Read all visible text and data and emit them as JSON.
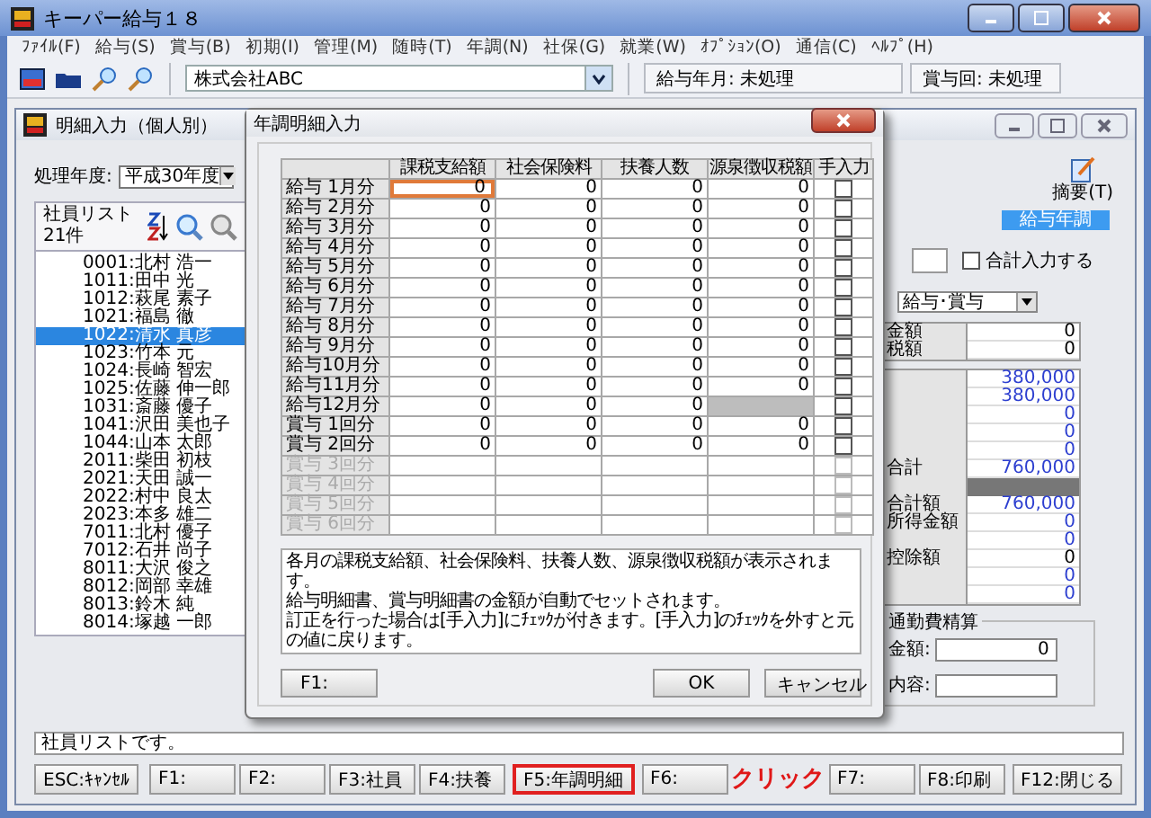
{
  "window": {
    "title": "キーパー給与１８"
  },
  "menu": [
    "ﾌｧｲﾙ(F)",
    "給与(S)",
    "賞与(B)",
    "初期(I)",
    "管理(M)",
    "随時(T)",
    "年調(N)",
    "社保(G)",
    "就業(W)",
    "ｵﾌﾟｼｮﾝ(O)",
    "通信(C)",
    "ﾍﾙﾌﾟ(H)"
  ],
  "toolbar": {
    "company": "株式会社ABC",
    "pay_month": "給与年月: 未処理",
    "bonus": "賞与回: 未処理"
  },
  "child_window": {
    "title": "明細入力（個人別）",
    "year_label": "処理年度:",
    "year": "平成30年度",
    "employee_list": {
      "title": "社員リスト",
      "count": "21件",
      "items": [
        {
          "label": "0001:北村 浩一",
          "selected": false
        },
        {
          "label": "1011:田中 光",
          "selected": false
        },
        {
          "label": "1012:萩尾 素子",
          "selected": false
        },
        {
          "label": "1021:福島 徹",
          "selected": false
        },
        {
          "label": "1022:清水 真彦",
          "selected": true
        },
        {
          "label": "1023:竹本 元",
          "selected": false
        },
        {
          "label": "1024:長崎 智宏",
          "selected": false
        },
        {
          "label": "1025:佐藤 伸一郎",
          "selected": false
        },
        {
          "label": "1031:斎藤 優子",
          "selected": false
        },
        {
          "label": "1041:沢田 美也子",
          "selected": false
        },
        {
          "label": "1044:山本 太郎",
          "selected": false
        },
        {
          "label": "2011:柴田 初枝",
          "selected": false
        },
        {
          "label": "2021:天田 誠一",
          "selected": false
        },
        {
          "label": "2022:村中 良太",
          "selected": false
        },
        {
          "label": "2023:本多 雄二",
          "selected": false
        },
        {
          "label": "7011:北村 優子",
          "selected": false
        },
        {
          "label": "7012:石井 尚子",
          "selected": false
        },
        {
          "label": "8011:大沢 俊之",
          "selected": false
        },
        {
          "label": "8012:岡部 幸雄",
          "selected": false
        },
        {
          "label": "8013:鈴木 純",
          "selected": false
        },
        {
          "label": "8014:塚越 一郎",
          "selected": false
        }
      ]
    },
    "summary_button": "摘要(T)",
    "tab": "給与年調",
    "total_input": {
      "label": "合計入力する",
      "checked": false
    },
    "type_select": "給与･賞与",
    "amounts_top": [
      {
        "label": "金額",
        "value": "0"
      },
      {
        "label": "税額",
        "value": "0"
      }
    ],
    "amounts": [
      {
        "kind": "value",
        "value": "380,000",
        "computed": true
      },
      {
        "kind": "value",
        "value": "380,000",
        "computed": true
      },
      {
        "kind": "value",
        "value": "0",
        "computed": true
      },
      {
        "kind": "value",
        "value": "0",
        "computed": true
      },
      {
        "kind": "value",
        "value": "0",
        "computed": true
      },
      {
        "kind": "value",
        "label": "合計",
        "value": "760,000",
        "computed": true
      },
      {
        "kind": "shaded"
      },
      {
        "kind": "value",
        "label": "合計額",
        "value": "760,000",
        "computed": true
      },
      {
        "kind": "value",
        "label": "所得金額",
        "value": "0",
        "computed": true
      },
      {
        "kind": "value",
        "value": "0",
        "computed": true
      },
      {
        "kind": "value",
        "label": "控除額",
        "value": "0",
        "computed": false
      },
      {
        "kind": "value",
        "value": "0",
        "computed": true
      },
      {
        "kind": "value",
        "value": "0",
        "computed": true
      }
    ],
    "commute": {
      "title": "通勤費精算",
      "amount_label": "金額:",
      "amount": "0",
      "note_label": "内容:"
    },
    "status": "社員リストです。",
    "function_keys": [
      {
        "label": "ESC:ｷｬﾝｾﾙ",
        "highlighted": false
      },
      {
        "label": "F1:",
        "highlighted": false
      },
      {
        "label": "F2:",
        "highlighted": false
      },
      {
        "label": "F3:社員",
        "highlighted": false
      },
      {
        "label": "F4:扶養",
        "highlighted": false
      },
      {
        "label": "F5:年調明細",
        "highlighted": true
      },
      {
        "label": "F6:",
        "highlighted": false
      },
      {
        "label": "F7:",
        "highlighted": false
      },
      {
        "label": "F8:印刷",
        "highlighted": false
      },
      {
        "label": "F12:閉じる",
        "highlighted": false
      }
    ],
    "annotation": "クリック"
  },
  "dialog": {
    "title": "年調明細入力",
    "columns": [
      "課税支給額",
      "社会保険料",
      "扶養人数",
      "源泉徴収税額",
      "手入力"
    ],
    "rows": [
      {
        "label": "給与 1月分",
        "values": [
          "0",
          "0",
          "0",
          "0"
        ],
        "manual": false,
        "disabled": false,
        "editing": true
      },
      {
        "label": "給与 2月分",
        "values": [
          "0",
          "0",
          "0",
          "0"
        ],
        "manual": false,
        "disabled": false,
        "editing": false
      },
      {
        "label": "給与 3月分",
        "values": [
          "0",
          "0",
          "0",
          "0"
        ],
        "manual": false,
        "disabled": false,
        "editing": false
      },
      {
        "label": "給与 4月分",
        "values": [
          "0",
          "0",
          "0",
          "0"
        ],
        "manual": false,
        "disabled": false,
        "editing": false
      },
      {
        "label": "給与 5月分",
        "values": [
          "0",
          "0",
          "0",
          "0"
        ],
        "manual": false,
        "disabled": false,
        "editing": false
      },
      {
        "label": "給与 6月分",
        "values": [
          "0",
          "0",
          "0",
          "0"
        ],
        "manual": false,
        "disabled": false,
        "editing": false
      },
      {
        "label": "給与 7月分",
        "values": [
          "0",
          "0",
          "0",
          "0"
        ],
        "manual": false,
        "disabled": false,
        "editing": false
      },
      {
        "label": "給与 8月分",
        "values": [
          "0",
          "0",
          "0",
          "0"
        ],
        "manual": false,
        "disabled": false,
        "editing": false
      },
      {
        "label": "給与 9月分",
        "values": [
          "0",
          "0",
          "0",
          "0"
        ],
        "manual": false,
        "disabled": false,
        "editing": false
      },
      {
        "label": "給与10月分",
        "values": [
          "0",
          "0",
          "0",
          "0"
        ],
        "manual": false,
        "disabled": false,
        "editing": false
      },
      {
        "label": "給与11月分",
        "values": [
          "0",
          "0",
          "0",
          "0"
        ],
        "manual": false,
        "disabled": false,
        "editing": false
      },
      {
        "label": "給与12月分",
        "values": [
          "0",
          "0",
          "0"
        ],
        "manual": false,
        "disabled": false,
        "editing": false
      },
      {
        "label": "賞与 1回分",
        "values": [
          "0",
          "0",
          "0",
          "0"
        ],
        "manual": false,
        "disabled": false,
        "editing": false
      },
      {
        "label": "賞与 2回分",
        "values": [
          "0",
          "0",
          "0",
          "0"
        ],
        "manual": false,
        "disabled": false,
        "editing": false
      },
      {
        "label": "賞与 3回分",
        "manual": false,
        "disabled": true,
        "editing": false
      },
      {
        "label": "賞与 4回分",
        "manual": false,
        "disabled": true,
        "editing": false
      },
      {
        "label": "賞与 5回分",
        "manual": false,
        "disabled": true,
        "editing": false
      },
      {
        "label": "賞与 6回分",
        "manual": false,
        "disabled": true,
        "editing": false
      }
    ],
    "message_lines": [
      "各月の課税支給額、社会保険料、扶養人数、源泉徴収税額が表示されます。",
      "給与明細書、賞与明細書の金額が自動でセットされます。",
      "訂正を行った場合は[手入力]にﾁｪｯｸが付きます。[手入力]のﾁｪｯｸを外すと元の値に戻ります。"
    ],
    "buttons": {
      "f1": "F1:",
      "ok": "OK",
      "cancel": "キャンセル"
    }
  }
}
